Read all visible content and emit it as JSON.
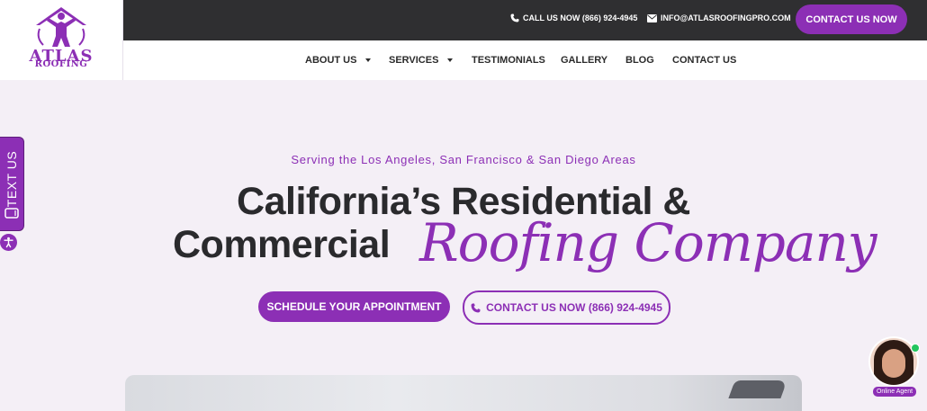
{
  "logo": {
    "top_text": "ATLAS",
    "bottom_text": "ROOFING",
    "icon": "atlas-figure-icon"
  },
  "topbar": {
    "call_label": "CALL US NOW (866) 924-4945",
    "email_label": "INFO@ATLASROOFINGPRO.COM",
    "contact_button": "CONTACT US NOW"
  },
  "nav": {
    "items": [
      {
        "label": "ABOUT US",
        "dropdown": true
      },
      {
        "label": "SERVICES",
        "dropdown": true
      },
      {
        "label": "TESTIMONIALS",
        "dropdown": false
      },
      {
        "label": "GALLERY",
        "dropdown": false
      },
      {
        "label": "BLOG",
        "dropdown": false
      },
      {
        "label": "CONTACT US",
        "dropdown": false
      }
    ]
  },
  "hero": {
    "subtitle": "Serving the Los Angeles, San Francisco & San Diego Areas",
    "line1": "California’s Residential &",
    "line2": "Commercial",
    "script": "Roofing Company",
    "primary_button": "SCHEDULE YOUR APPOINTMENT",
    "secondary_button": "CONTACT US NOW (866) 924-4945"
  },
  "side": {
    "text_us": "TEXT US",
    "accessibility_icon": "accessibility-icon"
  },
  "agent": {
    "label": "Online Agent"
  },
  "colors": {
    "brand": "#8c2fb5",
    "dark": "#2f2f31",
    "background": "#f4eff6"
  }
}
